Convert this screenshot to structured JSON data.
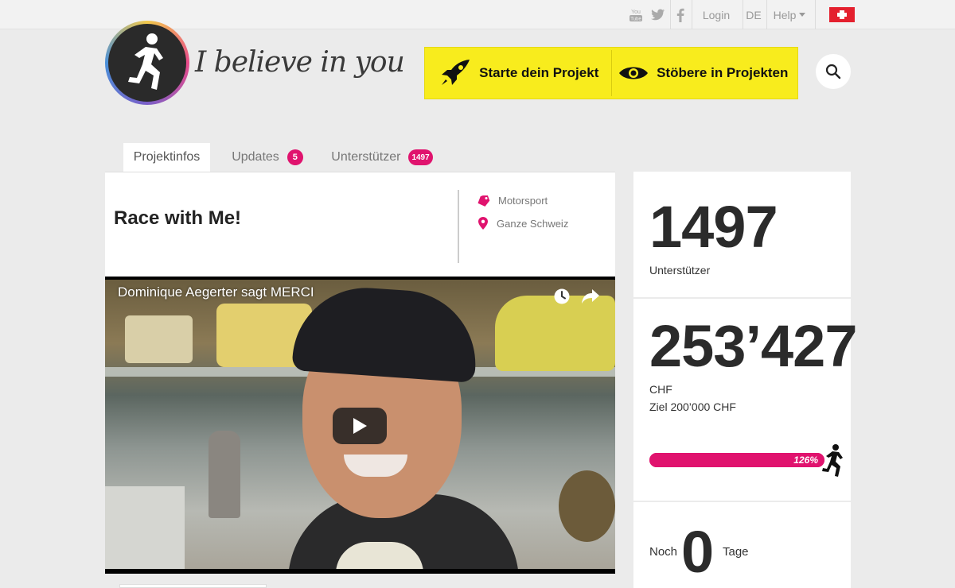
{
  "topbar": {
    "social": [
      {
        "name": "youtube-icon",
        "label": "You Tube"
      },
      {
        "name": "twitter-icon",
        "label": ""
      },
      {
        "name": "facebook-icon",
        "label": ""
      }
    ],
    "login": "Login",
    "language": "DE",
    "help": "Help",
    "flag": "switzerland-flag"
  },
  "brand": {
    "name": "I believe in you"
  },
  "cta": {
    "start": "Starte dein Projekt",
    "browse": "Stöbere in Projekten",
    "accent": "#f8ec1d"
  },
  "tabs": [
    {
      "label": "Projektinfos",
      "badge": ""
    },
    {
      "label": "Updates",
      "badge": "5"
    },
    {
      "label": "Unterstützer",
      "badge": "1497"
    }
  ],
  "project": {
    "title": "Race with Me!",
    "category": "Motorsport",
    "location": "Ganze Schweiz"
  },
  "video": {
    "title": "Dominique Aegerter sagt MERCI"
  },
  "stats": {
    "supporters_count": "1497",
    "supporters_label": "Unterstützer",
    "amount": "253’427",
    "currency": "CHF",
    "goal": "Ziel 200’000 CHF",
    "progress_label": "126%",
    "progress_fraction": 1.0,
    "days_prefix": "Noch",
    "days_value": "0",
    "days_suffix": "Tage"
  },
  "colors": {
    "pink": "#e0136e",
    "yellow": "#f8ec1d"
  }
}
